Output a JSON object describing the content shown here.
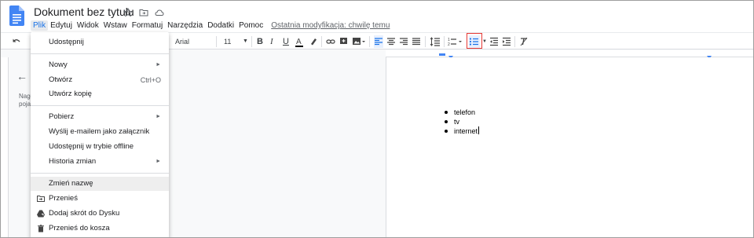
{
  "header": {
    "title": "Dokument bez tytułu",
    "last_edit": "Ostatnia modyfikacja: chwilę temu"
  },
  "menubar": [
    "Plik",
    "Edytuj",
    "Widok",
    "Wstaw",
    "Formatuj",
    "Narzędzia",
    "Dodatki",
    "Pomoc"
  ],
  "toolbar": {
    "font": "Arial",
    "font_size": "11",
    "active_button": "bulleted-list-button"
  },
  "outline": {
    "line1": "Nagł",
    "line2": "poja"
  },
  "document": {
    "list_items": [
      "telefon",
      "tv",
      "internet"
    ]
  },
  "file_menu": {
    "items": [
      {
        "label": "Udostępnij",
        "shortcut": ""
      },
      {
        "label": "Nowy",
        "shortcut": ""
      },
      {
        "label": "Otwórz",
        "shortcut": "Ctrl+O"
      },
      {
        "label": "Utwórz kopię",
        "shortcut": ""
      },
      {
        "label": "Pobierz",
        "shortcut": ""
      },
      {
        "label": "Wyślij e-mailem jako załącznik",
        "shortcut": ""
      },
      {
        "label": "Udostępnij w trybie offline",
        "shortcut": ""
      },
      {
        "label": "Historia zmian",
        "shortcut": ""
      },
      {
        "label": "Zmień nazwę",
        "shortcut": ""
      },
      {
        "label": "Przenieś",
        "shortcut": ""
      },
      {
        "label": "Dodaj skrót do Dysku",
        "shortcut": ""
      },
      {
        "label": "Przenieś do kosza",
        "shortcut": ""
      }
    ],
    "hovered": "Zmień nazwę"
  },
  "colors": {
    "accent": "#1a73e8",
    "highlight_box": "#e53935",
    "docs_blue": "#4285f4"
  }
}
